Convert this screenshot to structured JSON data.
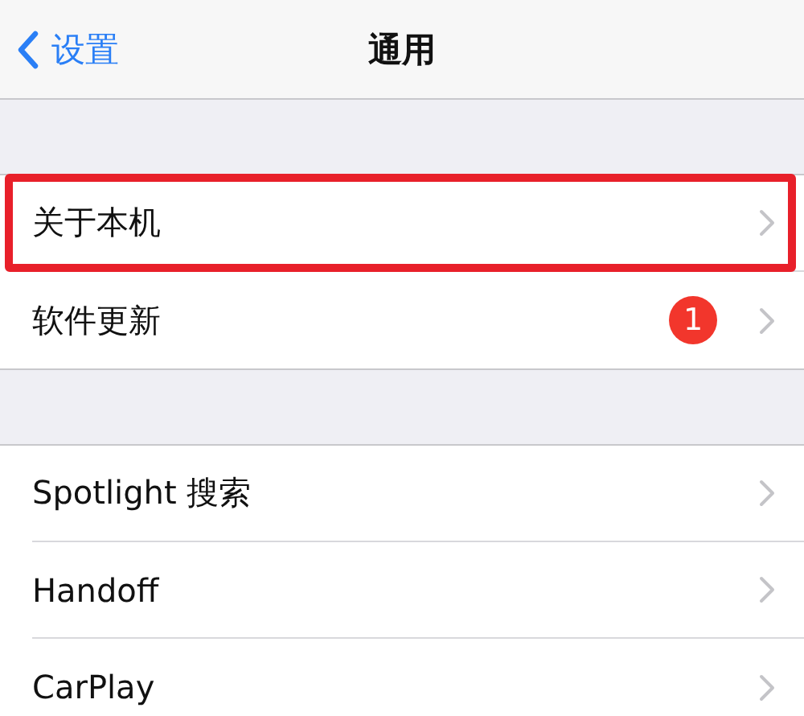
{
  "nav": {
    "back": "设置",
    "title": "通用"
  },
  "groups": [
    {
      "items": [
        {
          "label": "关于本机",
          "highlighted": true
        },
        {
          "label": "软件更新",
          "highlighted": false,
          "badge": "1"
        }
      ]
    },
    {
      "items": [
        {
          "label": "Spotlight 搜索",
          "highlighted": false
        },
        {
          "label": "Handoff",
          "highlighted": false
        },
        {
          "label": "CarPlay",
          "highlighted": false
        }
      ]
    }
  ]
}
